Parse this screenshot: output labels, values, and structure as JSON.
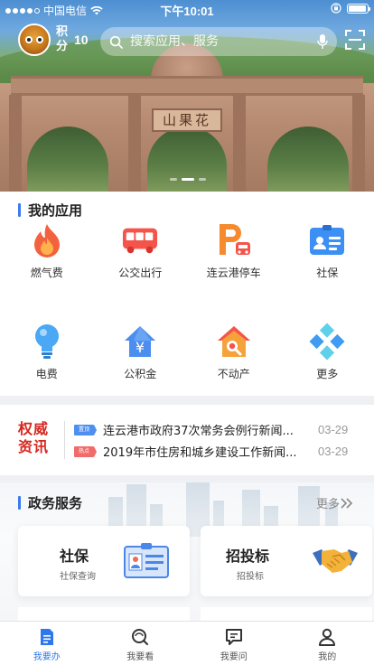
{
  "status_bar": {
    "carrier": "中国电信",
    "time": "下午10:01",
    "battery_level": 0.95
  },
  "header": {
    "points_label": "积分",
    "points_value": "10",
    "search_placeholder": "搜索应用、服务",
    "icons": [
      "search-icon",
      "mic-icon",
      "scan-icon"
    ]
  },
  "banner": {
    "sign_text": "山果花",
    "slide_count": 3,
    "active_slide": 2
  },
  "my_apps": {
    "title": "我的应用",
    "items": [
      {
        "label": "燃气费",
        "icon": "flame-icon"
      },
      {
        "label": "公交出行",
        "icon": "bus-icon"
      },
      {
        "label": "连云港停车",
        "icon": "parking-icon"
      },
      {
        "label": "社保",
        "icon": "id-card-icon"
      },
      {
        "label": "电费",
        "icon": "lightbulb-icon"
      },
      {
        "label": "公积金",
        "icon": "house-yuan-icon"
      },
      {
        "label": "不动产",
        "icon": "house-search-icon"
      },
      {
        "label": "更多",
        "icon": "more-diamonds-icon"
      }
    ]
  },
  "news": {
    "logo_line1": "权威",
    "logo_line2": "资讯",
    "items": [
      {
        "tag": "置顶",
        "text": "连云港市政府37次常务会例行新闻...",
        "date": "03-29",
        "tag_color": "#4f8ff0"
      },
      {
        "tag": "热点",
        "text": "2019年市住房和城乡建设工作新闻...",
        "date": "03-29",
        "tag_color": "#f26b6b"
      }
    ]
  },
  "gov_services": {
    "title": "政务服务",
    "more_label": "更多",
    "cards": [
      {
        "title": "社保",
        "subtitle": "社保查询"
      },
      {
        "title": "招投标",
        "subtitle": "招投标"
      }
    ]
  },
  "tabbar": {
    "items": [
      {
        "label": "我要办",
        "icon": "document-icon",
        "active": true
      },
      {
        "label": "我要看",
        "icon": "eye-search-icon",
        "active": false
      },
      {
        "label": "我要问",
        "icon": "chat-icon",
        "active": false
      },
      {
        "label": "我的",
        "icon": "person-icon",
        "active": false
      }
    ]
  },
  "colors": {
    "accent": "#2f77ec",
    "news_red": "#d6261e"
  }
}
